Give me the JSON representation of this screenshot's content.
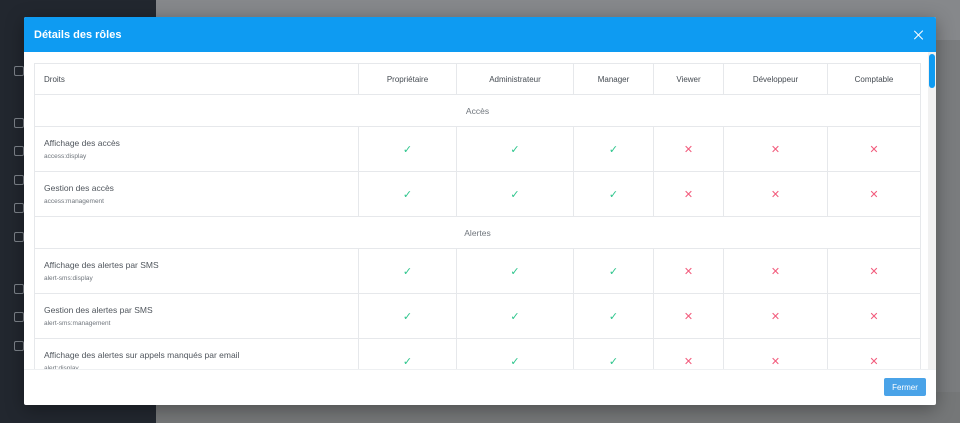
{
  "modal": {
    "title": "Détails des rôles",
    "close_label": "Fermer"
  },
  "table": {
    "columns": [
      "Droits",
      "Propriétaire",
      "Administrateur",
      "Manager",
      "Viewer",
      "Développeur",
      "Comptable"
    ],
    "sections": [
      {
        "name": "Accès",
        "rows": [
          {
            "label": "Affichage des accès",
            "code": "access:display",
            "perms": [
              true,
              true,
              true,
              false,
              false,
              false
            ]
          },
          {
            "label": "Gestion des accès",
            "code": "access:management",
            "perms": [
              true,
              true,
              true,
              false,
              false,
              false
            ]
          }
        ]
      },
      {
        "name": "Alertes",
        "rows": [
          {
            "label": "Affichage des alertes par SMS",
            "code": "alert-sms:display",
            "perms": [
              true,
              true,
              true,
              false,
              false,
              false
            ]
          },
          {
            "label": "Gestion des alertes par SMS",
            "code": "alert-sms:management",
            "perms": [
              true,
              true,
              true,
              false,
              false,
              false
            ]
          },
          {
            "label": "Affichage des alertes sur appels manqués par email",
            "code": "alert:display",
            "perms": [
              true,
              true,
              true,
              false,
              false,
              false
            ]
          }
        ]
      }
    ]
  },
  "icons": {
    "check": "check-icon",
    "cross": "cross-icon"
  },
  "colors": {
    "header": "#0e9bf2",
    "check": "#2dc58c",
    "cross": "#f25c7d",
    "button": "#4aa3e8"
  }
}
